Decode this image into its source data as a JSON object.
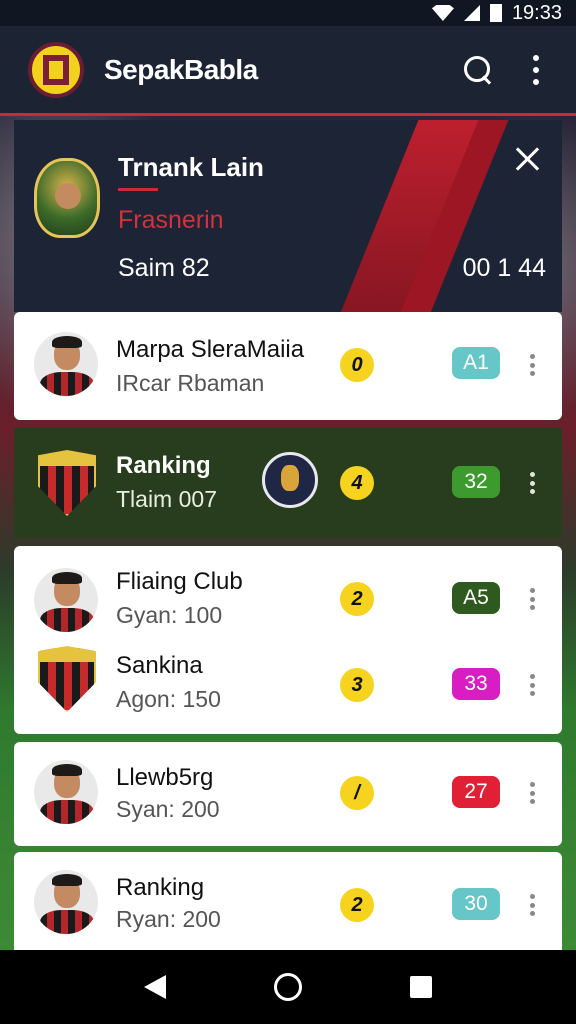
{
  "status_bar": {
    "time": "19:33"
  },
  "app_bar": {
    "title": "SepakBabla"
  },
  "featured": {
    "title": "Trnank Lain",
    "subtitle": "Frasnerin",
    "meta": "Saim 82",
    "time": "00 1 44"
  },
  "rows": [
    {
      "name": "Marpa SleraMaiia",
      "sub": "IRcar Rbaman",
      "rank": "0",
      "score": "A1",
      "score_color": "#66c6c8"
    },
    {
      "name": "Ranking",
      "sub": "Tlaim 007",
      "rank": "4",
      "score": "32",
      "score_color": "#3c9a2e"
    },
    {
      "name": "Fliaing Club",
      "sub": "Gyan: 100",
      "rank": "2",
      "score": "A5",
      "score_color": "#2f5a1f"
    },
    {
      "name": "Sankina",
      "sub": "Agon: 150",
      "rank": "3",
      "score": "33",
      "score_color": "#d81ec3"
    },
    {
      "name": "Llewb5rg",
      "sub": "Syan: 200",
      "rank": "/",
      "score": "27",
      "score_color": "#e11f35"
    },
    {
      "name": "Ranking",
      "sub": "Ryan: 200",
      "rank": "2",
      "score": "30",
      "score_color": "#66c6c8"
    }
  ],
  "colors": {
    "accent": "#c62b36",
    "rank_badge": "#f5d31e",
    "dark_row": "#283d1e"
  }
}
